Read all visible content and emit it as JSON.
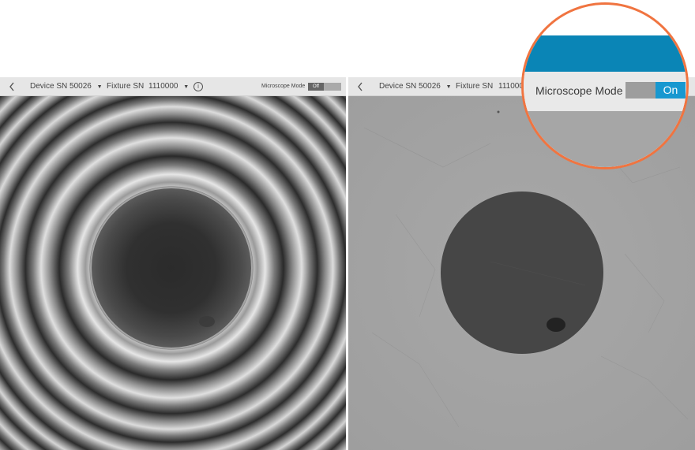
{
  "colors": {
    "toolbar_bg": "#e6e6e6",
    "accent_orange": "#f07440",
    "accent_blue": "#0a85b6",
    "toggle_on": "#1898d0"
  },
  "left_panel": {
    "toolbar": {
      "back_icon": "chevron-left-icon",
      "device_label": "Device SN 50026",
      "fixture_label": "Fixture SN",
      "fixture_value": "1110000",
      "info_icon": "info-icon",
      "microscope_label": "Microscope Mode",
      "microscope_state": "Off"
    },
    "image": {
      "description_icon": "interference-fringe-image"
    }
  },
  "right_panel": {
    "toolbar": {
      "back_icon": "chevron-left-icon",
      "device_label": "Device SN 50026",
      "fixture_label": "Fixture SN",
      "fixture_value": "1110000"
    },
    "image": {
      "description_icon": "fiber-endface-microscope-image"
    }
  },
  "zoom_callout": {
    "label": "Microscope Mode",
    "state": "On"
  }
}
